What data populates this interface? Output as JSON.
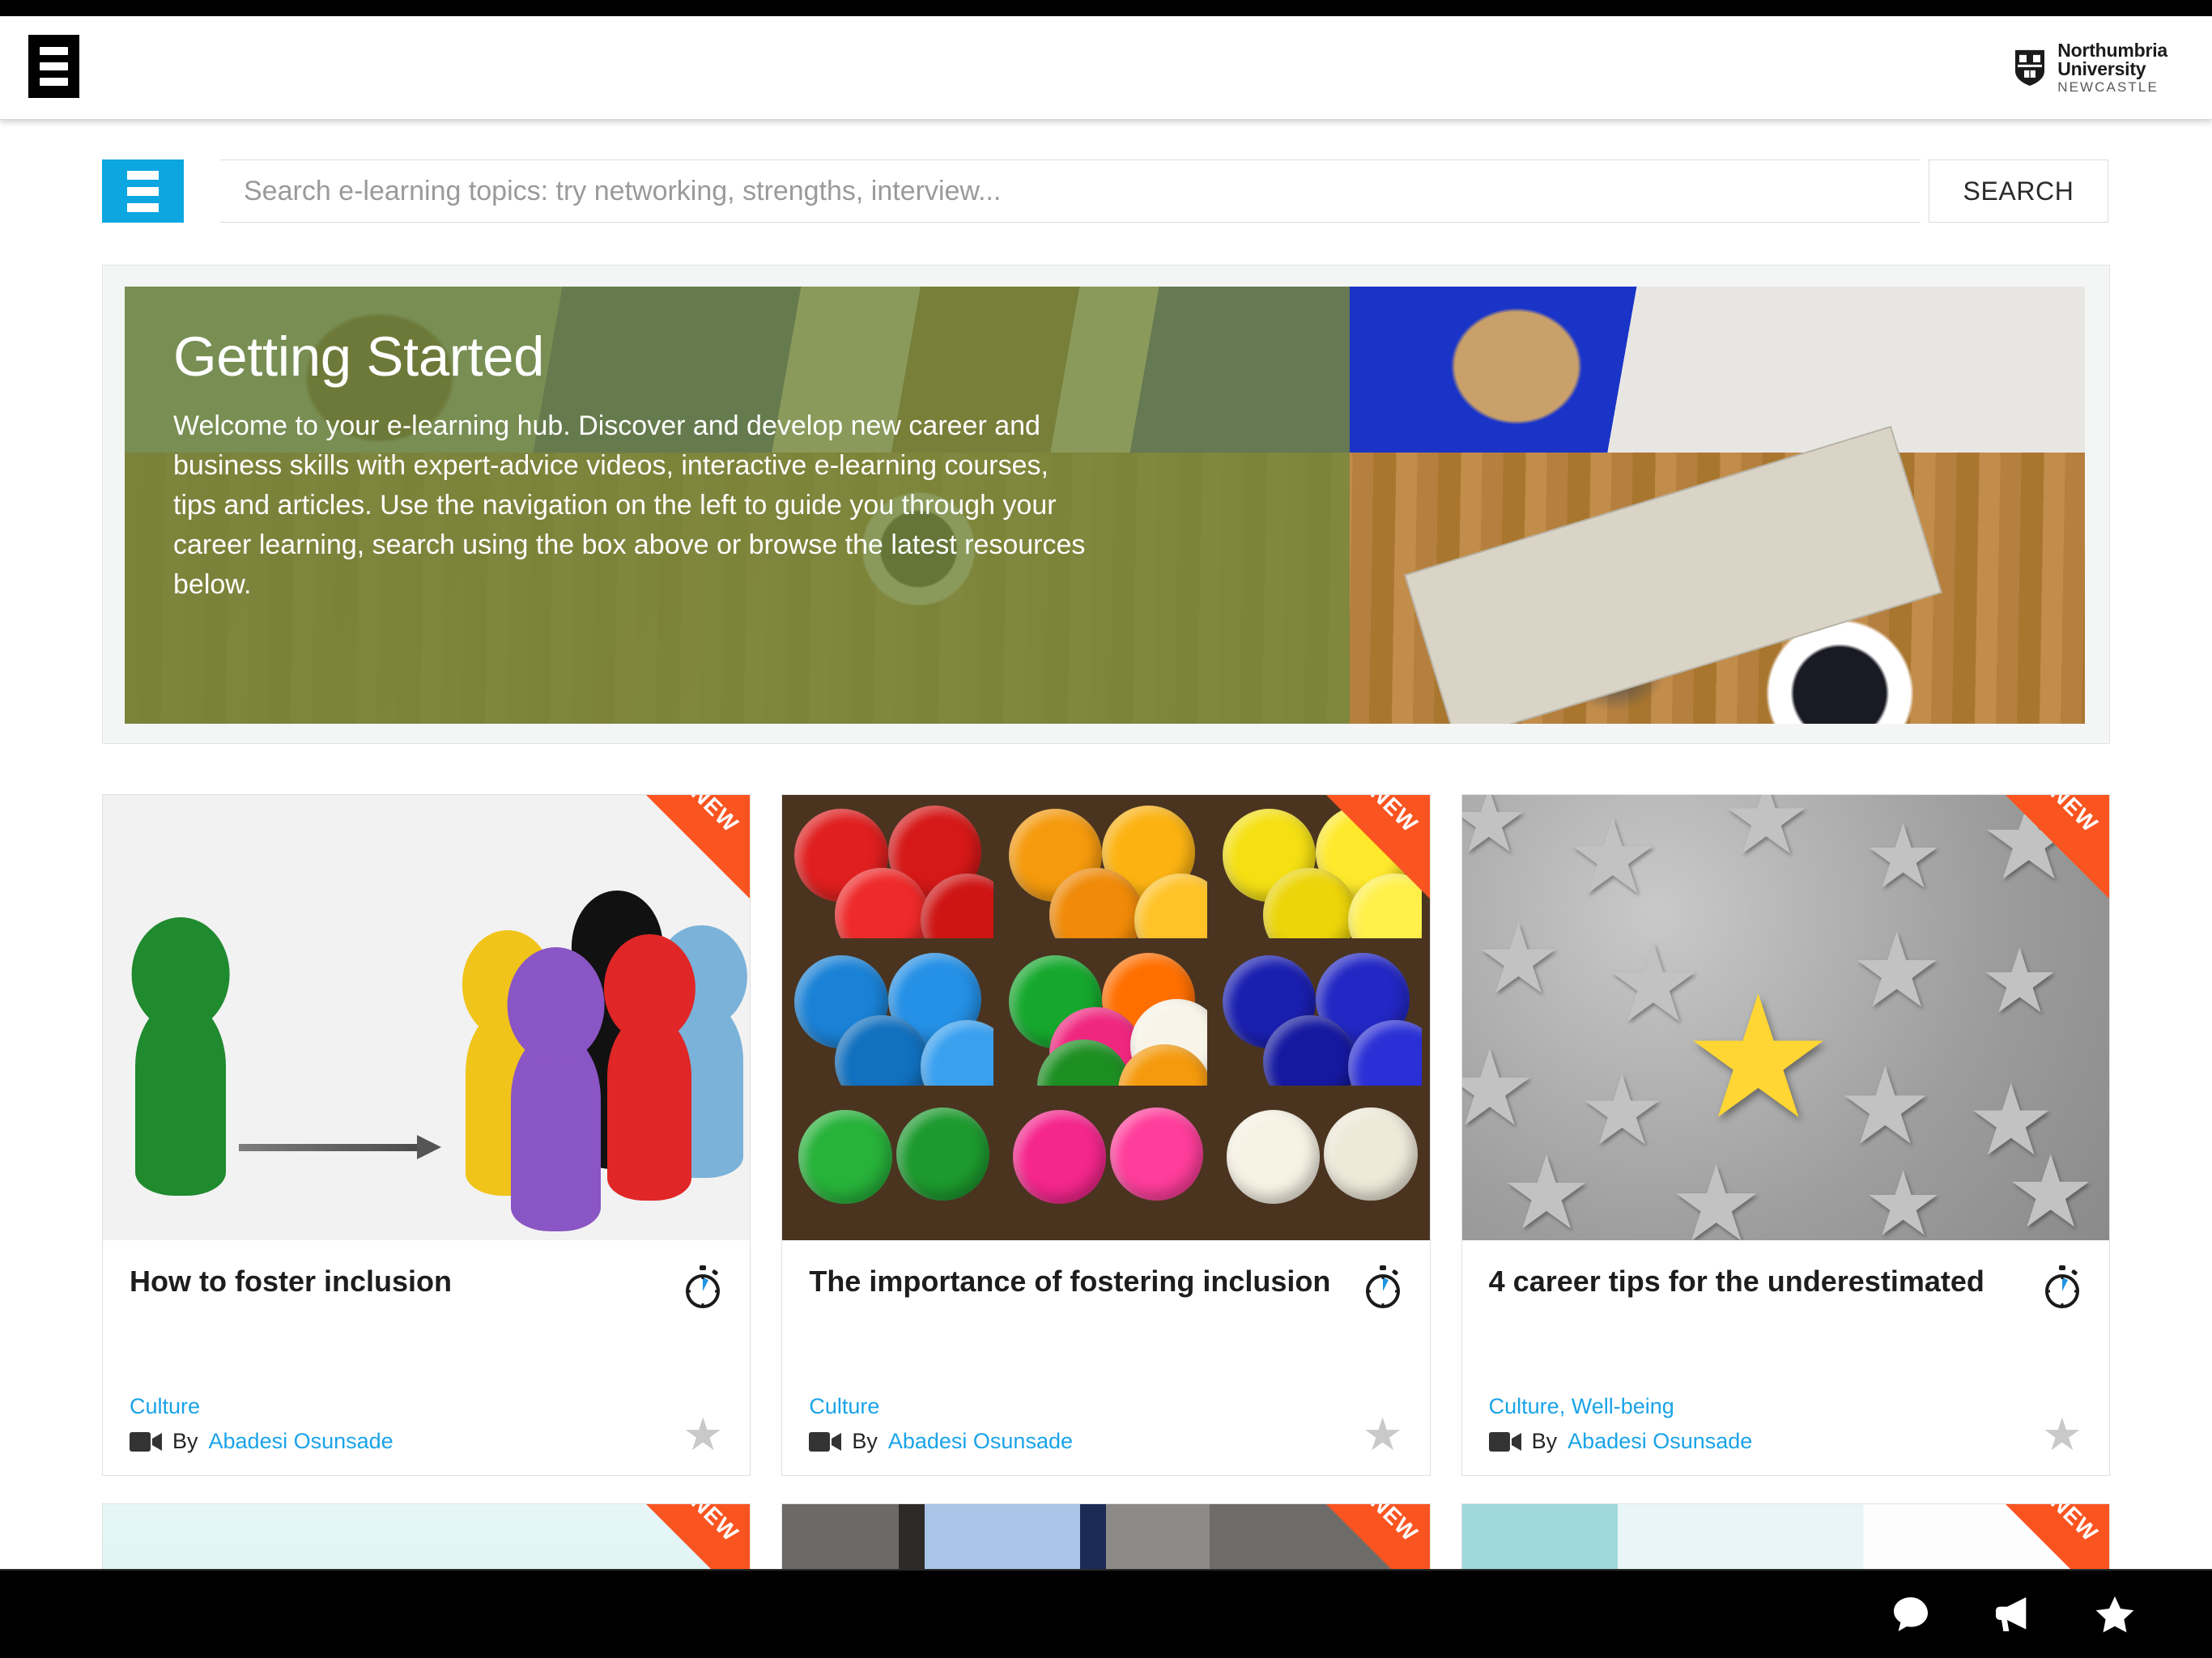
{
  "header": {
    "menu_icon": "hamburger-menu-icon",
    "logo": {
      "line1": "Northumbria",
      "line2": "University",
      "line3": "NEWCASTLE",
      "crest_icon": "university-crest-icon"
    }
  },
  "search": {
    "toggle_icon": "filter-menu-icon",
    "placeholder": "Search e-learning topics: try networking, strengths, interview...",
    "value": "",
    "button_label": "SEARCH"
  },
  "hero": {
    "title": "Getting Started",
    "body": "Welcome to your e-learning hub. Discover and develop new career and business skills with expert-advice videos, interactive e-learning courses, tips and articles. Use the navigation on the left to guide you through your career learning, search using the box above or browse the latest resources below.",
    "overlay_color": "#73873c",
    "image_alt": "overhead-photo-people-at-table"
  },
  "badge": {
    "new_label": "NEW",
    "new_color": "#fa5420"
  },
  "byline_prefix": "By",
  "cards": [
    {
      "title": "How to foster inclusion",
      "tags": "Culture",
      "author": "Abadesi Osunsade",
      "new": true,
      "media": "game-pawns-photo",
      "duration_icon": "stopwatch-icon",
      "type_icon": "video-camera-icon",
      "favourite_icon": "star-icon"
    },
    {
      "title": "The importance of fostering inclusion",
      "tags": "Culture",
      "author": "Abadesi Osunsade",
      "new": true,
      "media": "sorted-colour-balls-photo",
      "duration_icon": "stopwatch-icon",
      "type_icon": "video-camera-icon",
      "favourite_icon": "star-icon"
    },
    {
      "title": "4 career tips for the underestimated",
      "tags": "Culture, Well-being",
      "author": "Abadesi Osunsade",
      "new": true,
      "media": "yellow-star-among-grey-stars-photo",
      "duration_icon": "stopwatch-icon",
      "type_icon": "video-camera-icon",
      "favourite_icon": "star-icon"
    }
  ],
  "cards_partial": [
    {
      "media": "pale-cyan-photo",
      "new": true
    },
    {
      "media": "business-people-suits-photo",
      "new": true
    },
    {
      "media": "teal-white-gradient-photo",
      "new": true
    }
  ],
  "footer": {
    "chat_icon": "speech-bubble-icon",
    "announcements_icon": "megaphone-icon",
    "favourites_icon": "star-icon"
  },
  "colors": {
    "accent_blue": "#0ca6e0",
    "link_blue": "#1aa3e8",
    "new_orange": "#fa5420",
    "hero_green": "#73873c"
  }
}
